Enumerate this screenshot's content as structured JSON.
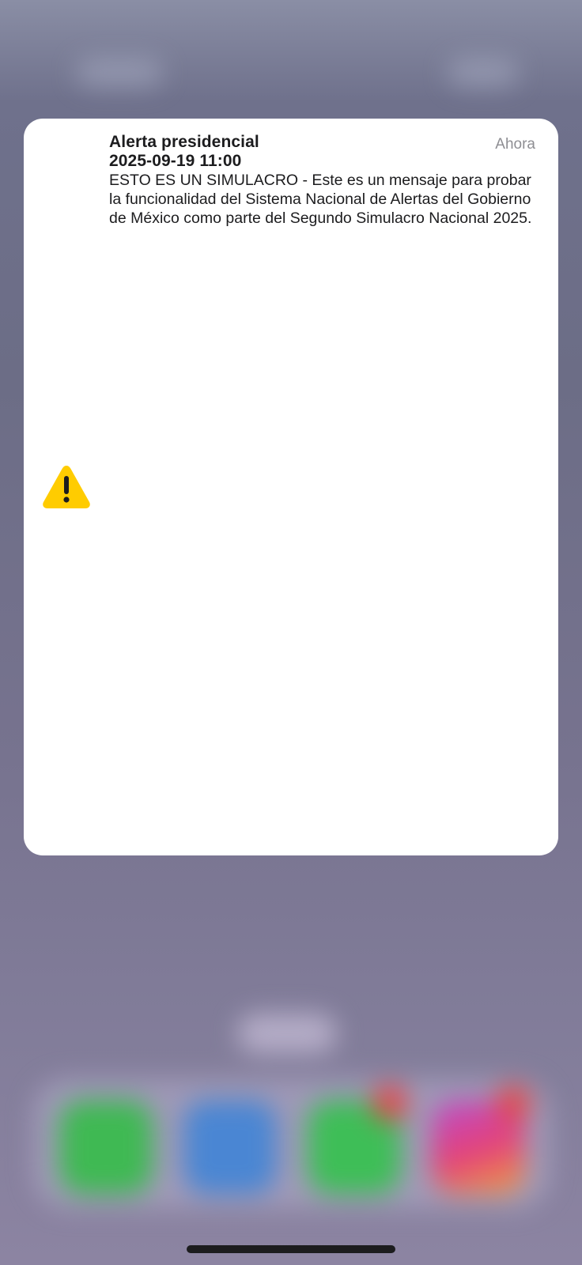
{
  "alert": {
    "title": "Alerta presidencial",
    "datetime": "2025-09-19 11:00",
    "message": "ESTO ES UN SIMULACRO - Este es un mensaje para probar la funcionalidad del Sistema Nacional de Alertas del Gobierno de México como parte del Segundo Simulacro Nacional 2025.",
    "time": "Ahora",
    "icon": "warning-icon",
    "icon_color": "#FFCC00"
  },
  "dock": {
    "apps": [
      "phone-icon",
      "safari-icon",
      "messages-icon",
      "instagram-icon"
    ]
  },
  "colors": {
    "card_background": "#FFFFFF",
    "secondary_text": "#8E8E93",
    "primary_text": "#1C1C1E"
  }
}
